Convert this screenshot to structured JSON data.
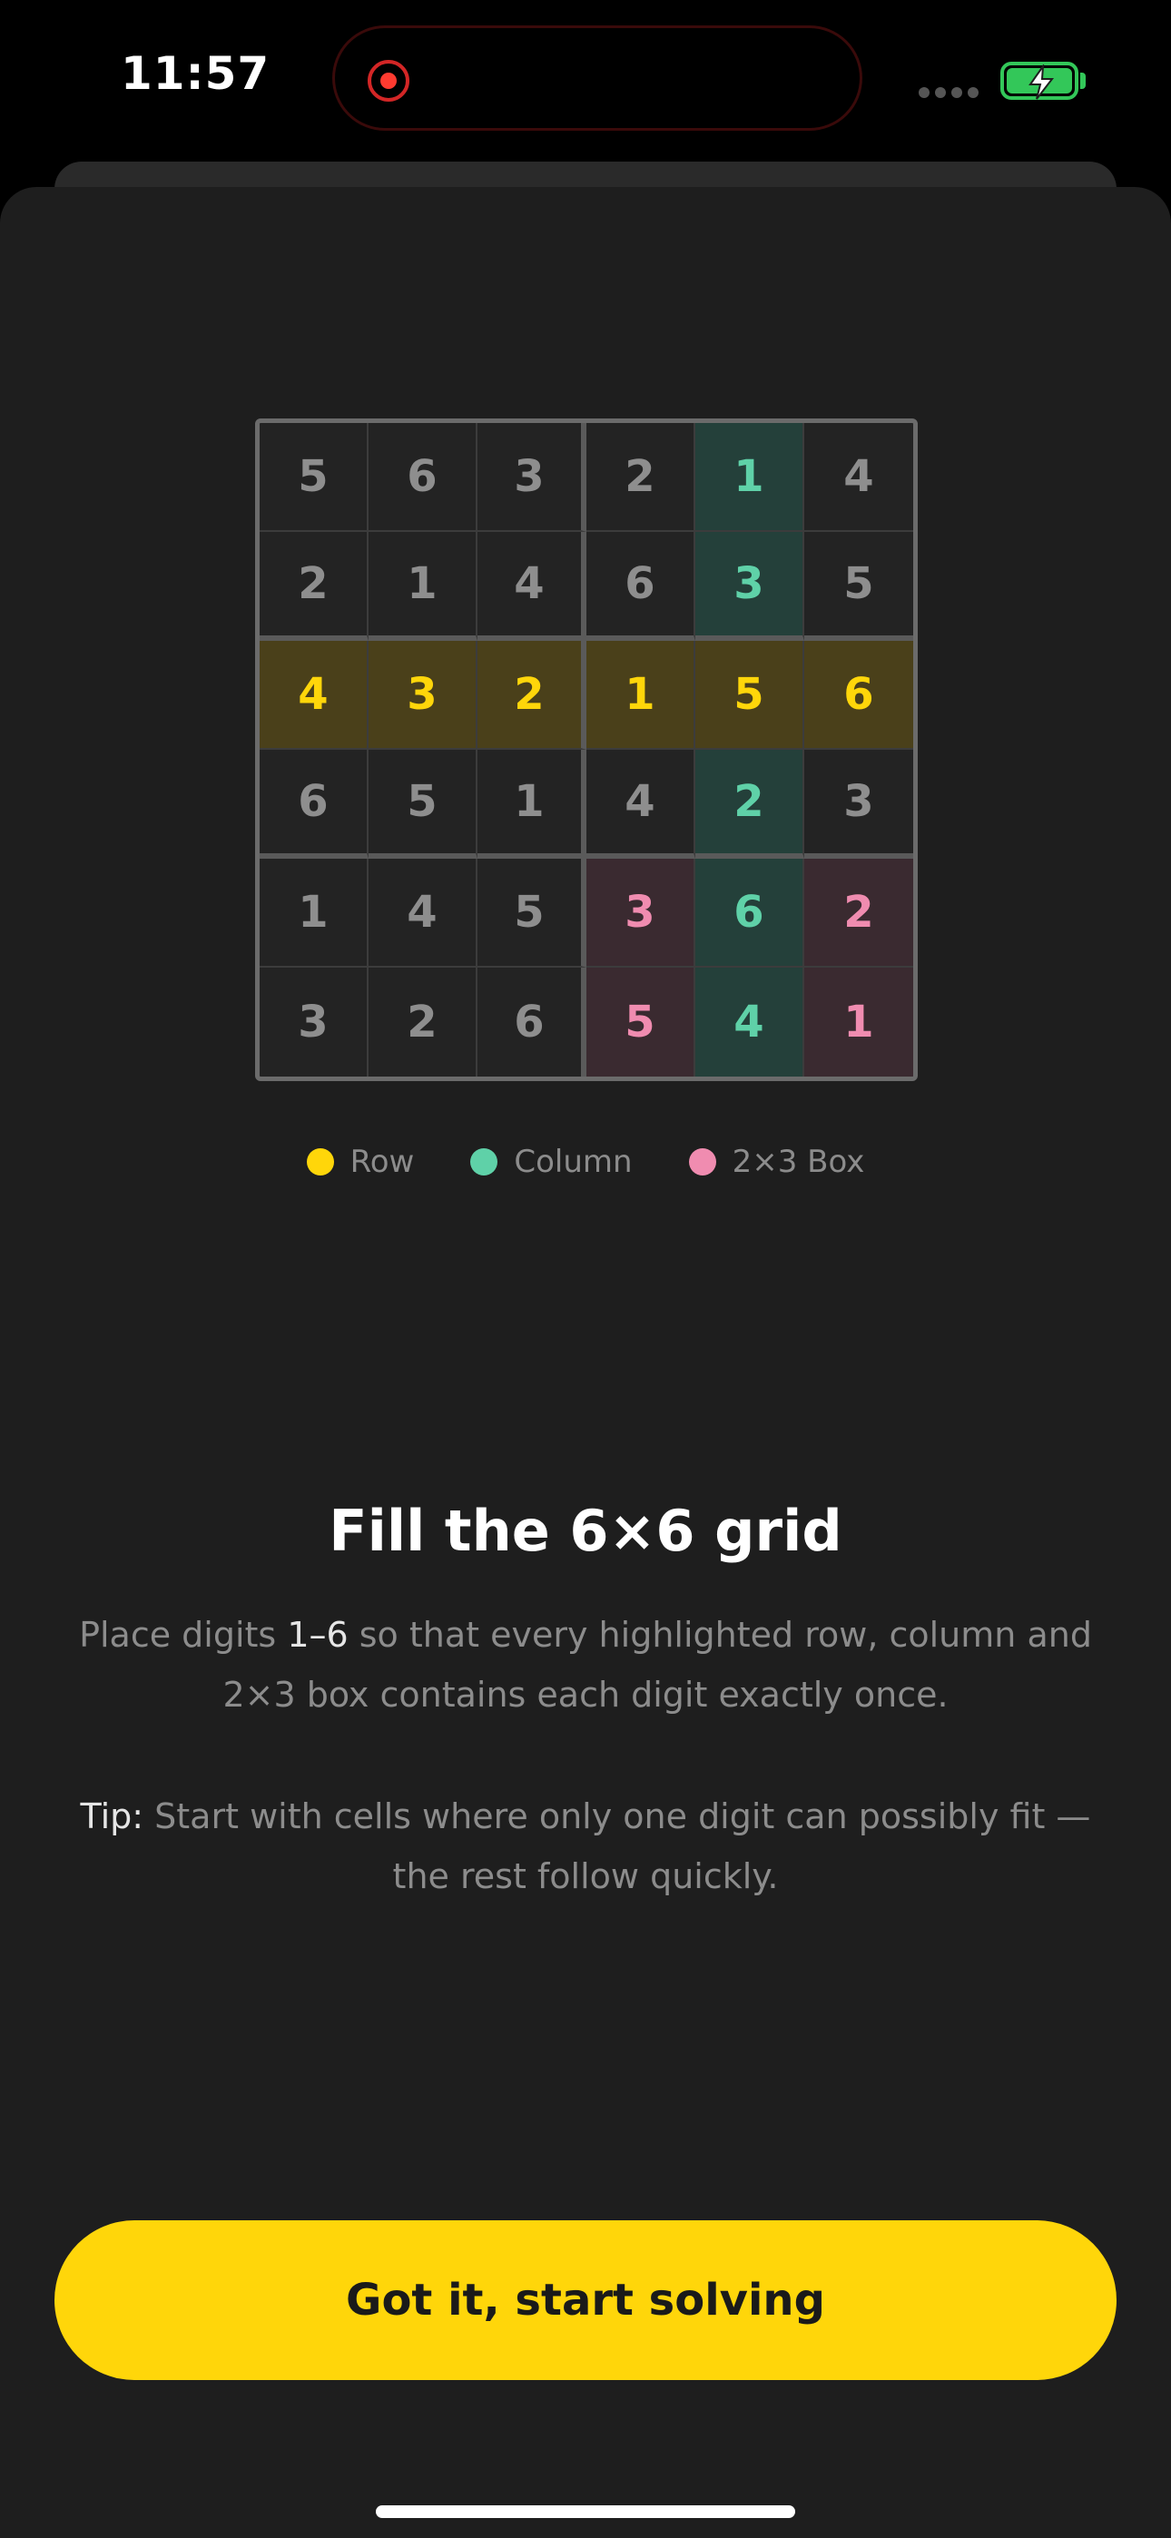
{
  "status_bar": {
    "time": "11:57"
  },
  "grid": {
    "rows": [
      [
        "5",
        "6",
        "3",
        "2",
        "1",
        "4"
      ],
      [
        "2",
        "1",
        "4",
        "6",
        "3",
        "5"
      ],
      [
        "4",
        "3",
        "2",
        "1",
        "5",
        "6"
      ],
      [
        "6",
        "5",
        "1",
        "4",
        "2",
        "3"
      ],
      [
        "1",
        "4",
        "5",
        "3",
        "6",
        "2"
      ],
      [
        "3",
        "2",
        "6",
        "5",
        "4",
        "1"
      ]
    ],
    "highlight_row_index": 2,
    "highlight_column_index": 4,
    "highlight_box": {
      "rows": [
        4,
        5
      ],
      "cols": [
        3,
        4,
        5
      ]
    }
  },
  "legend": [
    {
      "label": "Row",
      "color": "#ffd60a"
    },
    {
      "label": "Column",
      "color": "#5fd1a8"
    },
    {
      "label": "2×3 Box",
      "color": "#f08cb0"
    }
  ],
  "intro": {
    "title": "Fill the 6×6 grid",
    "body_prefix": "Place digits ",
    "body_emphasis": "1–6",
    "body_suffix": " so that every highlighted row, column and 2×3 box contains each digit exactly once.",
    "tip_label": "Tip:",
    "tip_text": " Start with cells where only one digit can possibly fit — the rest follow quickly."
  },
  "cta": {
    "label": "Got it, start solving"
  },
  "colors": {
    "accent": "#ffd60a",
    "column": "#5fd1a8",
    "box": "#f08cb0",
    "background": "#1e1e1e"
  }
}
